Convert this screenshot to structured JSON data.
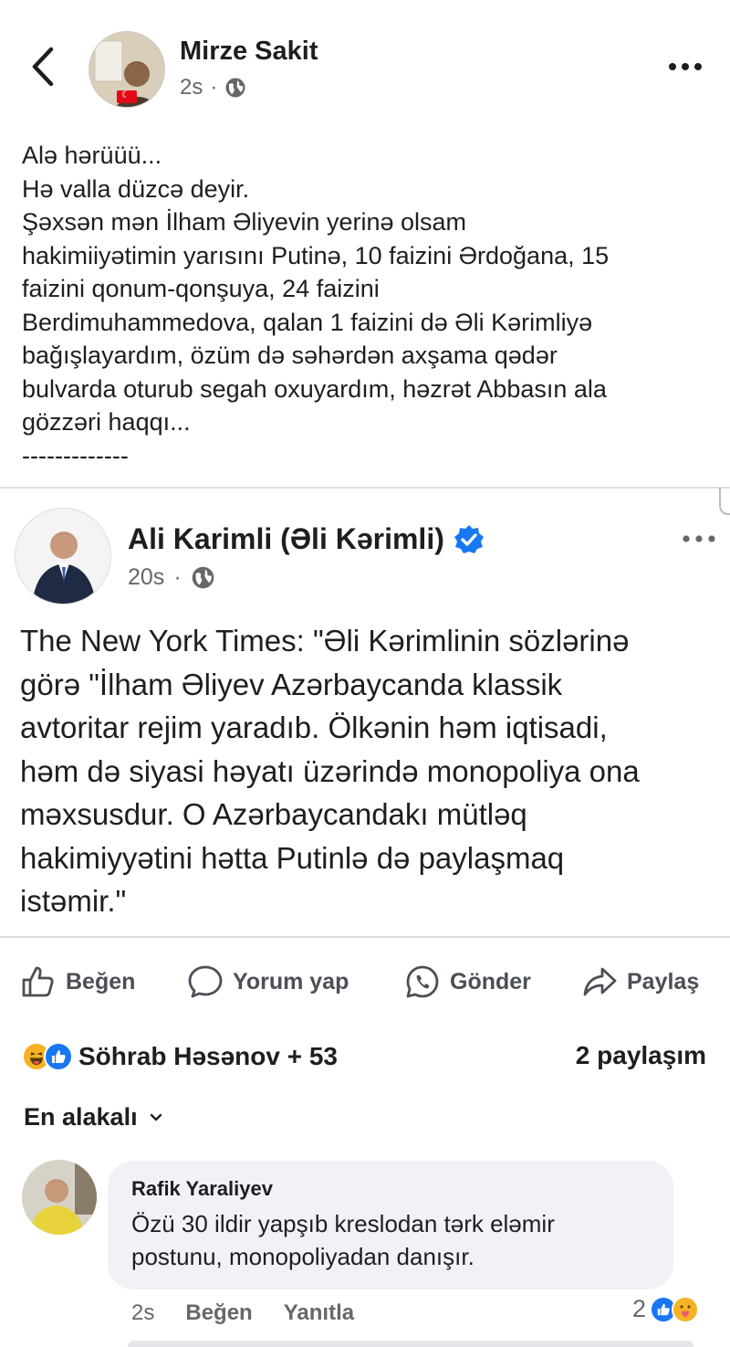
{
  "post": {
    "author": "Mirze Sakit",
    "time": "2s",
    "separator": "·",
    "lines": [
      "Alə hərüüü...",
      "Hə valla düzcə deyir.",
      "Şəxsən mən İlham Əliyevin yerinə olsam",
      "hakimiiyətimin yarısını Putinə, 10 faizini Ərdoğana, 15",
      "faizini qonum-qonşuya, 24 faizini",
      "Berdimuhammedova, qalan 1 faizini də  Əli Kərimliyə",
      "bağışlayardım, özüm də səhərdən axşama qədər",
      "bulvarda oturub segah oxuyardım, həzrət Abbasın ala",
      "gözzəri haqqı...",
      "-------------"
    ]
  },
  "shared": {
    "author": "Ali Karimli (Əli Kərimli)",
    "time": "20s",
    "separator": "·",
    "lines": [
      "The New York Times: \"Əli Kərimlinin sözlərinə",
      "görə \"İlham Əliyev Azərbaycanda klassik",
      "avtoritar rejim yaradıb. Ölkənin həm iqtisadi,",
      "həm də siyasi həyatı üzərində monopoliya ona",
      "məxsusdur. O Azərbaycandakı mütləq",
      "hakimiyyətini hətta Putinlə də paylaşmaq",
      "istəmir.\""
    ]
  },
  "actions": {
    "like": "Beğen",
    "comment": "Yorum yap",
    "send": "Gönder",
    "share": "Paylaş"
  },
  "reactions": {
    "names": "Söhrab Həsənov + 53",
    "shares": "2 paylaşım"
  },
  "sort": {
    "label": "En alakalı"
  },
  "comment": {
    "author": "Rafik Yaraliyev",
    "lines": [
      "Özü  30 ildir yapşıb kreslodan tərk eləmir",
      "postunu, monopoliyadan danışır."
    ],
    "time": "2s",
    "like": "Beğen",
    "reply": "Yanıtla",
    "reaction_count": "2"
  },
  "colors": {
    "accent": "#1877f2",
    "secondary_text": "#65676b",
    "bubble": "#f0f2f5"
  }
}
